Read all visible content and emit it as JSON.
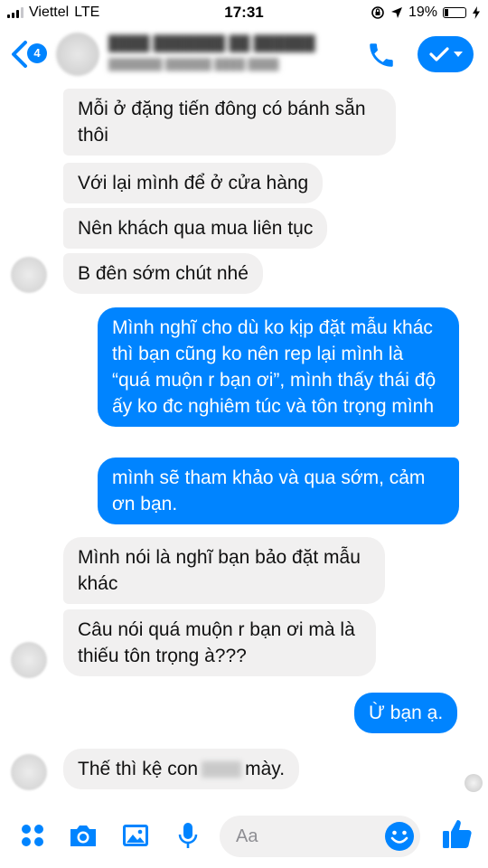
{
  "status_bar": {
    "carrier": "Viettel",
    "network": "LTE",
    "time": "17:31",
    "battery_percent": "19%",
    "battery_level": 0.19
  },
  "header": {
    "back_badge": "4"
  },
  "messages": [
    {
      "type": "received",
      "text": "Mỗi ở đặng tiến đông có bánh sẵn thôi"
    },
    {
      "type": "received",
      "text": "Với lại mình để ở cửa hàng"
    },
    {
      "type": "received",
      "text": "Nên khách qua mua liên tục"
    },
    {
      "type": "received",
      "text": "B đên sớm chút nhé"
    },
    {
      "type": "sent",
      "text": "Mình nghĩ cho dù ko kịp đặt mẫu khác thì bạn cũng ko nên rep lại mình là “quá muộn r bạn ơi”, mình thấy thái độ ấy ko đc nghiêm túc và tôn trọng mình"
    },
    {
      "type": "sent",
      "text": "mình sẽ tham khảo và qua sớm, cảm ơn bạn."
    },
    {
      "type": "received",
      "text": "Mình nói là nghĩ bạn bảo đặt mẫu khác"
    },
    {
      "type": "received",
      "text": "Câu nói quá muộn r bạn ơi mà là thiếu tôn trọng à???"
    },
    {
      "type": "sent",
      "text": "Ừ bạn ạ."
    },
    {
      "type": "received",
      "text_before": "Thế thì kệ con",
      "text_after": "mày."
    }
  ],
  "composer": {
    "placeholder": "Aa"
  },
  "colors": {
    "accent": "#0084ff",
    "received_bubble": "#f1f0f0"
  }
}
